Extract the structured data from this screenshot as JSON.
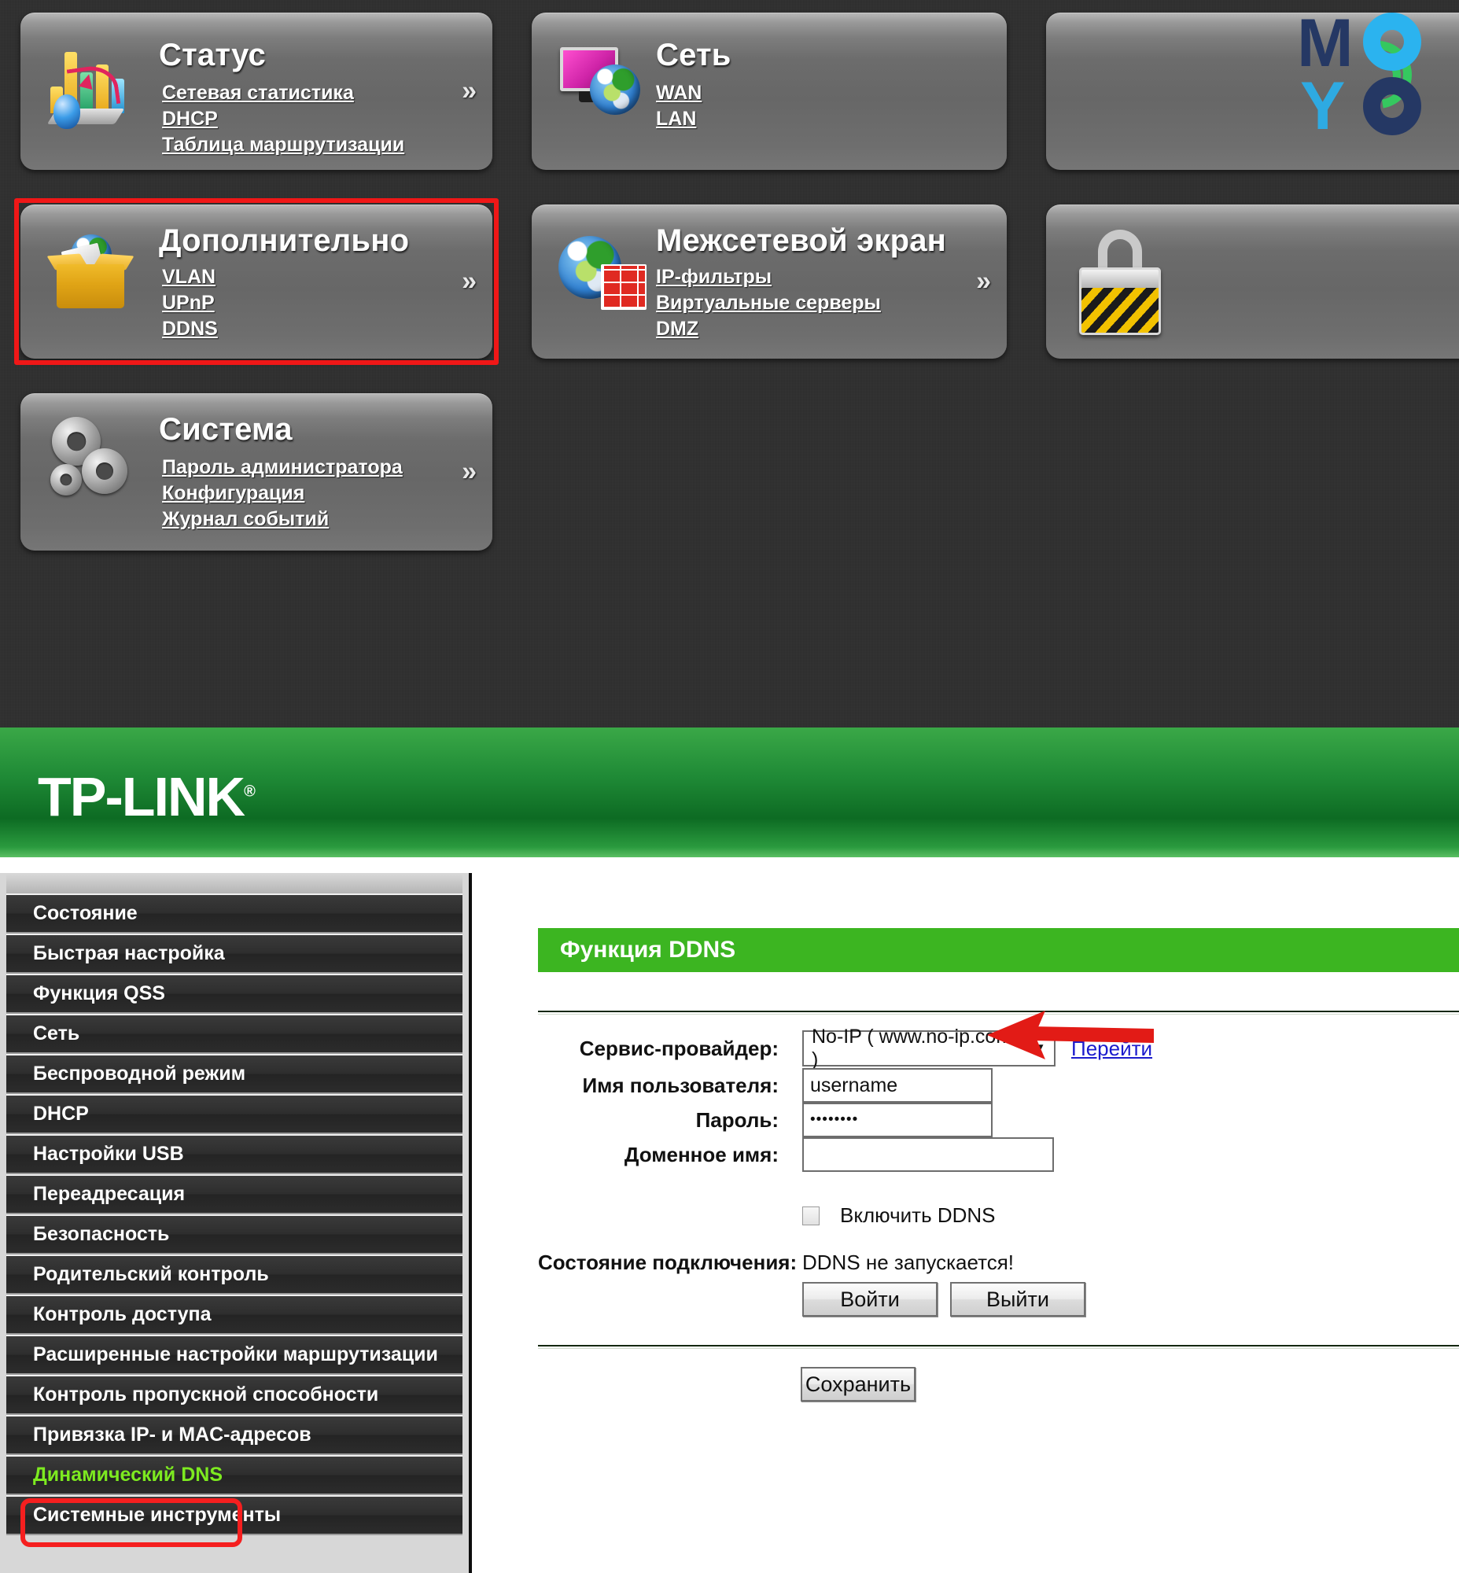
{
  "dlink_dashboard": {
    "cards": [
      {
        "id": "status",
        "title": "Статус",
        "icon": "chart-icon",
        "links": [
          "Сетевая статистика",
          "DHCP",
          "Таблица маршрутизации"
        ],
        "chevron": "»"
      },
      {
        "id": "network",
        "title": "Сеть",
        "icon": "monitor-globe-icon",
        "links": [
          "WAN",
          "LAN"
        ],
        "chevron": ""
      },
      {
        "id": "advanced",
        "title": "Дополнительно",
        "icon": "open-box-icon",
        "links": [
          "VLAN",
          "UPnP",
          "DDNS"
        ],
        "chevron": "»",
        "highlighted": true
      },
      {
        "id": "firewall",
        "title": "Межсетевой экран",
        "icon": "firewall-globe-brick-icon",
        "links": [
          "IP-фильтры",
          "Виртуальные серверы",
          "DMZ"
        ],
        "chevron": "»"
      },
      {
        "id": "system",
        "title": "Система",
        "icon": "gears-icon",
        "links": [
          "Пароль администратора",
          "Конфигурация",
          "Журнал событий"
        ],
        "chevron": "»"
      },
      {
        "id": "security-partial",
        "title": "",
        "icon": "padlock-icon",
        "links": [],
        "chevron": ""
      }
    ],
    "watermark": {
      "name": "moyo-logo",
      "letters": [
        "M",
        "O",
        "Y",
        "O"
      ],
      "colors": {
        "dark_navy": "#253864",
        "light_blue": "#2bb3ef",
        "green": "#35c85f"
      }
    },
    "highlight_color": "#f01717"
  },
  "tplink": {
    "brand": "TP-LINK",
    "brand_mark": "®",
    "brand_color": "#1f8a36",
    "sidebar": {
      "items": [
        {
          "label": "Состояние",
          "active": false
        },
        {
          "label": "Быстрая настройка",
          "active": false
        },
        {
          "label": "Функция QSS",
          "active": false
        },
        {
          "label": "Сеть",
          "active": false
        },
        {
          "label": "Беспроводной режим",
          "active": false
        },
        {
          "label": "DHCP",
          "active": false
        },
        {
          "label": "Настройки USB",
          "active": false
        },
        {
          "label": "Переадресация",
          "active": false
        },
        {
          "label": "Безопасность",
          "active": false
        },
        {
          "label": "Родительский контроль",
          "active": false
        },
        {
          "label": "Контроль доступа",
          "active": false
        },
        {
          "label": "Расширенные настройки маршрутизации",
          "active": false
        },
        {
          "label": "Контроль пропускной способности",
          "active": false
        },
        {
          "label": "Привязка IP- и MAC-адресов",
          "active": false
        },
        {
          "label": "Динамический DNS",
          "active": true
        },
        {
          "label": "Системные инструменты",
          "active": false
        }
      ],
      "active_color": "#7dea20",
      "highlight_color": "#f51f1f"
    },
    "content": {
      "banner_title": "Функция DDNS",
      "fields": {
        "provider_label": "Сервис-провайдер:",
        "provider_value": "No-IP ( www.no-ip.com )",
        "provider_go_link": "Перейти",
        "username_label": "Имя пользователя:",
        "username_value": "username",
        "password_label": "Пароль:",
        "password_value": "••••••••",
        "domain_label": "Доменное имя:",
        "domain_value": ""
      },
      "enable_ddns_label": "Включить DDNS",
      "enable_ddns_checked": false,
      "status_label": "Состояние подключения:",
      "status_value": "DDNS не запускается!",
      "login_button": "Войти",
      "logout_button": "Выйти",
      "save_button": "Сохранить",
      "arrow_annotation_color": "#e21b16"
    }
  }
}
